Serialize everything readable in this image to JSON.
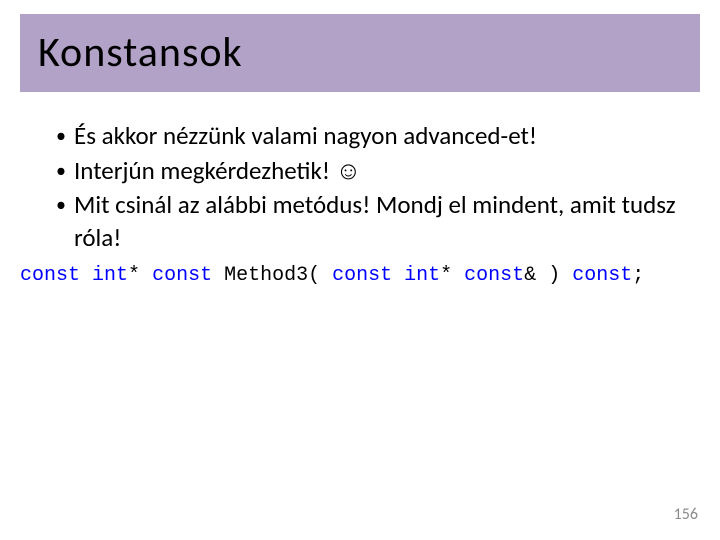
{
  "title": "Konstansok",
  "bullets": [
    "És akkor nézzünk valami nagyon advanced-et!",
    "Interjún megkérdezhetik! ☺",
    "Mit csinál az alábbi metódus! Mondj el mindent, amit tudsz róla!"
  ],
  "code": {
    "t0": "const",
    "t1": " ",
    "t2": "int",
    "t3": "* ",
    "t4": "const",
    "t5": " Method3( ",
    "t6": "const",
    "t7": " ",
    "t8": "int",
    "t9": "* ",
    "t10": "const",
    "t11": "& ) ",
    "t12": "const",
    "t13": ";"
  },
  "pageNumber": "156"
}
